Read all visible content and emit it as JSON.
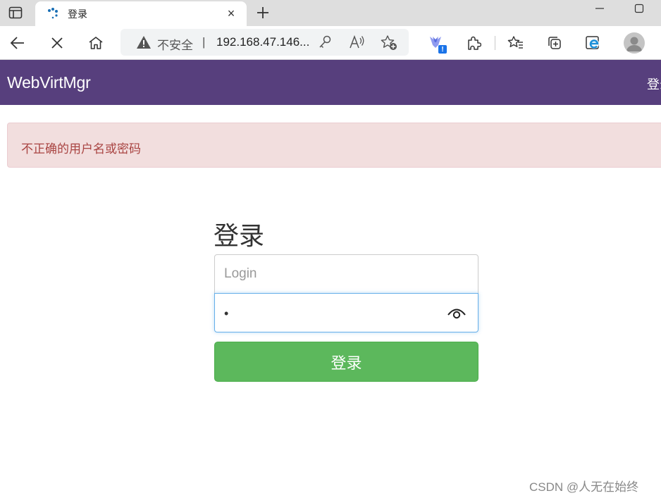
{
  "tab": {
    "title": "登录",
    "close_glyph": "×"
  },
  "address": {
    "insecure_label": "不安全",
    "separator": "|",
    "url": "192.168.47.146..."
  },
  "extension_badge": "!",
  "icons": {
    "sidebar": "tab-sidebar-icon",
    "loading": "loading-spinner-icon",
    "new_tab": "plus-icon",
    "back": "back-arrow-icon",
    "stop": "stop-icon",
    "home": "home-icon",
    "warning": "warning-icon",
    "key": "key-icon",
    "read_aloud": "read-aloud-icon",
    "add_favorite": "add-favorite-icon",
    "extension": "extension-icon",
    "puzzle": "extensions-puzzle-icon",
    "favorites": "favorites-icon",
    "collections": "collections-icon",
    "ie_mode": "ie-mode-icon",
    "profile": "profile-avatar-icon",
    "show_password": "eye-icon"
  },
  "navbar": {
    "brand": "WebVirtMgr",
    "login_link": "登录"
  },
  "alert": {
    "message": "不正确的用户名或密码"
  },
  "form": {
    "title": "登录",
    "login_placeholder": "Login",
    "password_mask": "•",
    "submit_label": "登录"
  },
  "watermark": "CSDN @人无在始终",
  "colors": {
    "navbar": "#573f7d",
    "alert_bg": "#f2dede",
    "alert_text": "#a94442",
    "button": "#5cb85c",
    "focus_border": "#66afe9"
  }
}
